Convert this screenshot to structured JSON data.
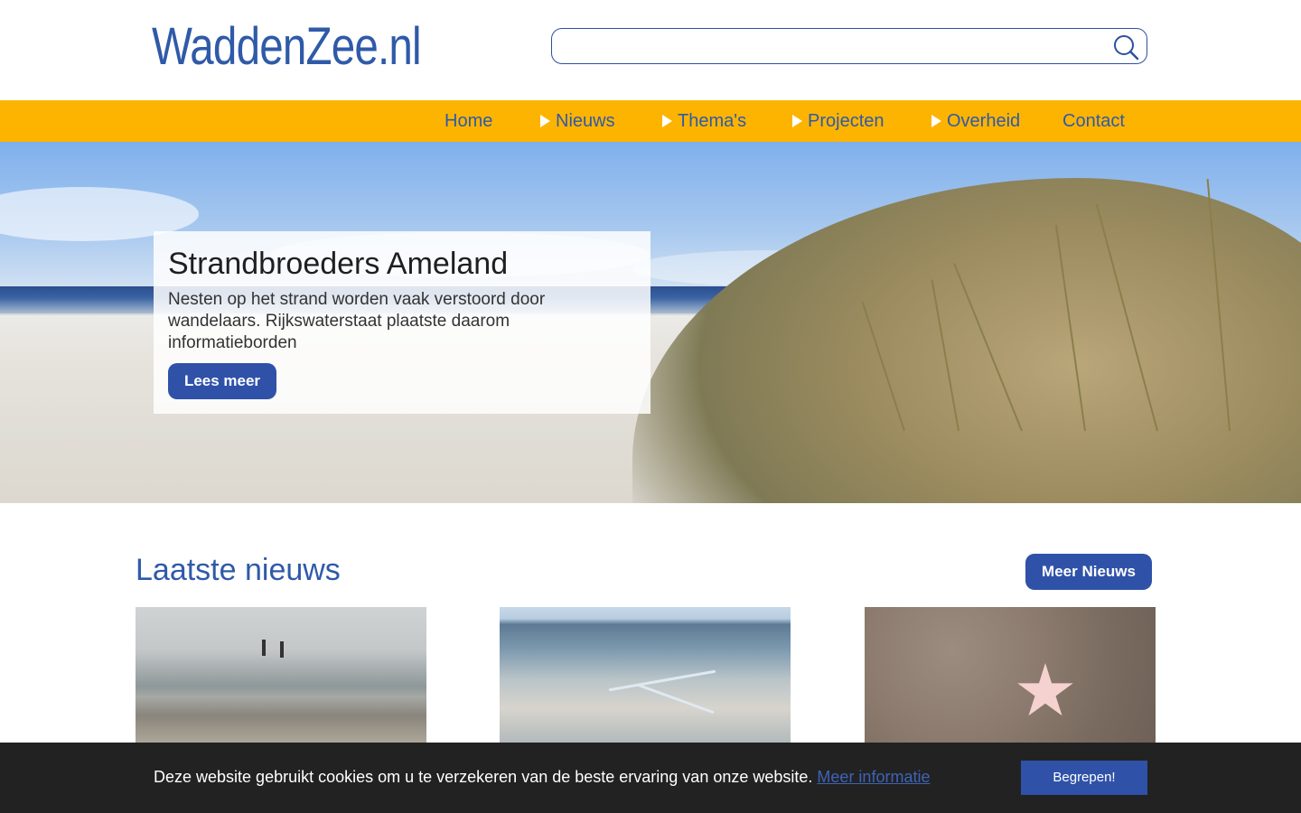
{
  "header": {
    "logo": "WaddenZee.nl",
    "search": {
      "placeholder": "",
      "value": ""
    }
  },
  "nav": {
    "items": [
      {
        "label": "Home",
        "has_arrow": false
      },
      {
        "label": "Nieuws",
        "has_arrow": true
      },
      {
        "label": "Thema's",
        "has_arrow": true
      },
      {
        "label": "Projecten",
        "has_arrow": true
      },
      {
        "label": "Overheid",
        "has_arrow": true
      },
      {
        "label": "Contact",
        "has_arrow": false
      }
    ]
  },
  "hero": {
    "title": "Strandbroeders Ameland",
    "text": "Nesten op het strand worden vaak verstoord door wandelaars. Rijkswaterstaat plaatste daarom informatieborden",
    "button": "Lees meer"
  },
  "news": {
    "title": "Laatste nieuws",
    "more_button": "Meer Nieuws"
  },
  "cookie": {
    "text": "Deze website gebruikt cookies om u te verzekeren van de beste ervaring van onze website.",
    "link": "Meer informatie",
    "button": "Begrepen!"
  },
  "colors": {
    "brand_blue": "#2f5aa8",
    "nav_yellow": "#fdb400",
    "button_blue": "#2f52a8",
    "cookie_bg": "#222222"
  },
  "icons": [
    "search-icon",
    "nav-arrow-icon"
  ]
}
